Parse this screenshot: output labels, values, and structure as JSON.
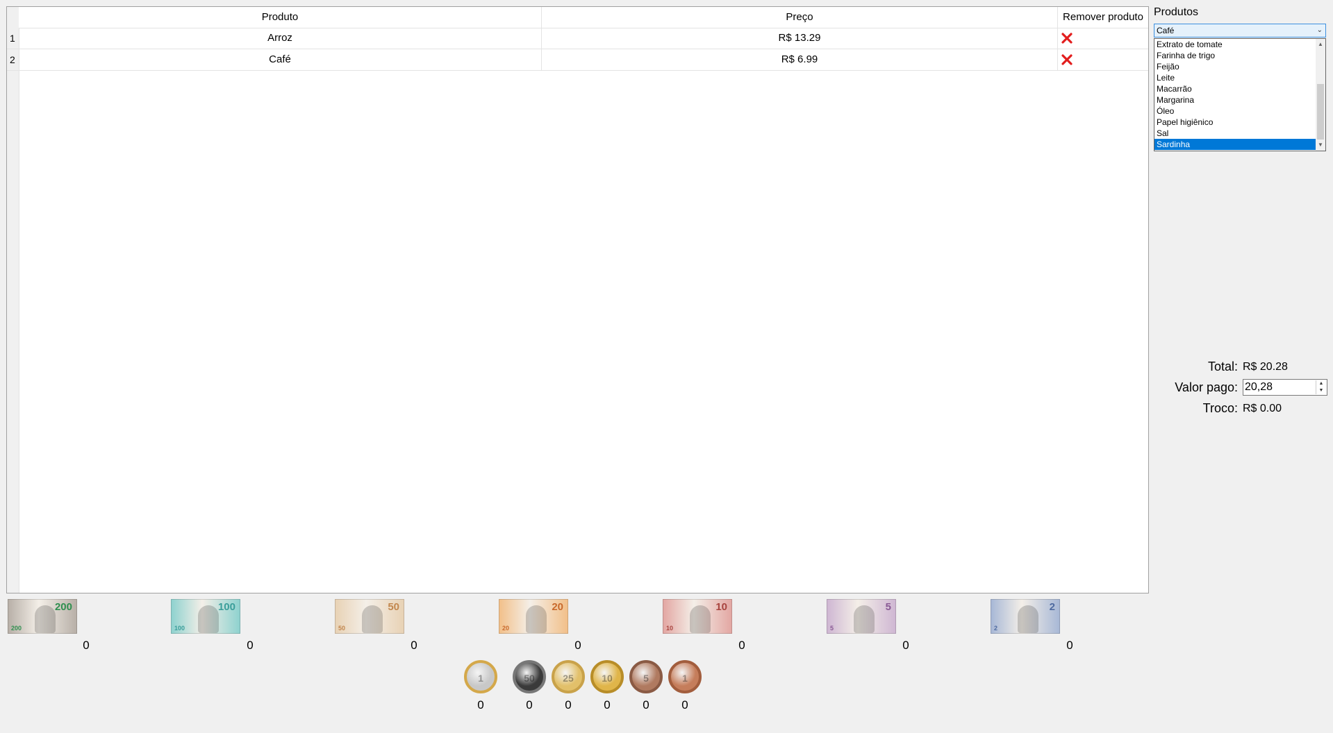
{
  "table": {
    "headers": {
      "product": "Produto",
      "price": "Preço",
      "remove": "Remover produto"
    },
    "rows": [
      {
        "index": "1",
        "product": "Arroz",
        "price": "R$ 13.29"
      },
      {
        "index": "2",
        "product": "Café",
        "price": "R$ 6.99"
      }
    ]
  },
  "products_panel": {
    "label": "Produtos",
    "selected": "Café",
    "options": [
      "Extrato de tomate",
      "Farinha de trigo",
      "Feijão",
      "Leite",
      "Macarrão",
      "Margarina",
      "Óleo",
      "Papel higiênico",
      "Sal",
      "Sardinha"
    ],
    "highlighted": "Sardinha"
  },
  "summary": {
    "total_label": "Total:",
    "total_value": "R$ 20.28",
    "paid_label": "Valor pago:",
    "paid_value": "20,28",
    "change_label": "Troco:",
    "change_value": "R$ 0.00"
  },
  "notes": [
    {
      "value": "200",
      "count": "0",
      "color": "#b8b0a8",
      "accent": "#2f8f4f"
    },
    {
      "value": "100",
      "count": "0",
      "color": "#8fd2cf",
      "accent": "#3a9e9a"
    },
    {
      "value": "50",
      "count": "0",
      "color": "#e8d2b5",
      "accent": "#c2874e"
    },
    {
      "value": "20",
      "count": "0",
      "color": "#f2c08a",
      "accent": "#c96a2c"
    },
    {
      "value": "10",
      "count": "0",
      "color": "#e3a7a3",
      "accent": "#a8443f"
    },
    {
      "value": "5",
      "count": "0",
      "color": "#cfb7d3",
      "accent": "#8a5a95"
    },
    {
      "value": "2",
      "count": "0",
      "color": "#a8b8d6",
      "accent": "#4e6aa0"
    }
  ],
  "coins": [
    {
      "value": "1",
      "count": "0",
      "color": "#c8c8c8",
      "ring": "#d4a84a"
    },
    {
      "value": "50",
      "count": "0",
      "color": "#3a3a3a",
      "ring": "#777777"
    },
    {
      "value": "25",
      "count": "0",
      "color": "#e2c06a",
      "ring": "#c9a24a"
    },
    {
      "value": "10",
      "count": "0",
      "color": "#e0b54a",
      "ring": "#b88d28"
    },
    {
      "value": "5",
      "count": "0",
      "color": "#b07a60",
      "ring": "#8a5a44"
    },
    {
      "value": "1",
      "count": "0",
      "color": "#c57d5b",
      "ring": "#a25d3d"
    }
  ]
}
